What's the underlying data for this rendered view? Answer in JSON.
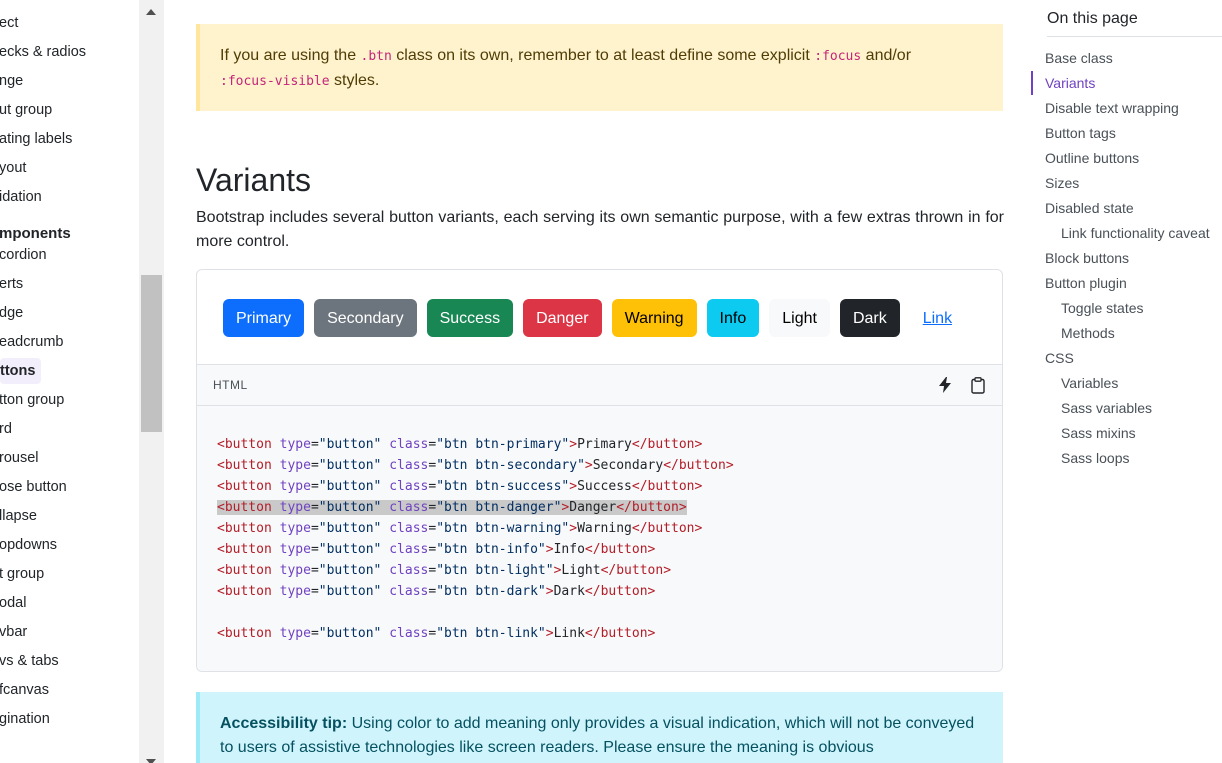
{
  "sidebar": {
    "items": [
      {
        "label": "ect",
        "kind": "item"
      },
      {
        "label": "ecks & radios",
        "kind": "item"
      },
      {
        "label": "nge",
        "kind": "item"
      },
      {
        "label": "ut group",
        "kind": "item"
      },
      {
        "label": "ating labels",
        "kind": "item"
      },
      {
        "label": "yout",
        "kind": "item"
      },
      {
        "label": "idation",
        "kind": "item"
      },
      {
        "label": "mponents",
        "kind": "heading"
      },
      {
        "label": "cordion",
        "kind": "item"
      },
      {
        "label": "erts",
        "kind": "item"
      },
      {
        "label": "dge",
        "kind": "item"
      },
      {
        "label": "eadcrumb",
        "kind": "item"
      },
      {
        "label": "ttons",
        "kind": "active"
      },
      {
        "label": "tton group",
        "kind": "item"
      },
      {
        "label": "rd",
        "kind": "item"
      },
      {
        "label": "rousel",
        "kind": "item"
      },
      {
        "label": "ose button",
        "kind": "item"
      },
      {
        "label": "llapse",
        "kind": "item"
      },
      {
        "label": "opdowns",
        "kind": "item"
      },
      {
        "label": "t group",
        "kind": "item"
      },
      {
        "label": "odal",
        "kind": "item"
      },
      {
        "label": "vbar",
        "kind": "item"
      },
      {
        "label": "vs & tabs",
        "kind": "item"
      },
      {
        "label": "fcanvas",
        "kind": "item"
      },
      {
        "label": "gination",
        "kind": "item"
      }
    ]
  },
  "callout_warning": {
    "before": "If you are using the ",
    "code1": ".btn",
    "middle": " class on its own, remember to at least define some explicit ",
    "code2": ":focus",
    "and": " and/or ",
    "code3": ":focus-visible",
    "after": " styles."
  },
  "section": {
    "title": "Variants",
    "lead": "Bootstrap includes several button variants, each serving its own semantic purpose, with a few extras thrown in for more control."
  },
  "buttons": [
    {
      "label": "Primary",
      "variant": "primary"
    },
    {
      "label": "Secondary",
      "variant": "secondary"
    },
    {
      "label": "Success",
      "variant": "success"
    },
    {
      "label": "Danger",
      "variant": "danger"
    },
    {
      "label": "Warning",
      "variant": "warning"
    },
    {
      "label": "Info",
      "variant": "info"
    },
    {
      "label": "Light",
      "variant": "light"
    },
    {
      "label": "Dark",
      "variant": "dark"
    },
    {
      "label": "Link",
      "variant": "link"
    }
  ],
  "code": {
    "language": "HTML",
    "lines": [
      {
        "cls": "btn btn-primary",
        "text": "Primary"
      },
      {
        "cls": "btn btn-secondary",
        "text": "Secondary"
      },
      {
        "cls": "btn btn-success",
        "text": "Success"
      },
      {
        "cls": "btn btn-danger",
        "text": "Danger",
        "highlighted": true
      },
      {
        "cls": "btn btn-warning",
        "text": "Warning"
      },
      {
        "cls": "btn btn-info",
        "text": "Info"
      },
      {
        "cls": "btn btn-light",
        "text": "Light"
      },
      {
        "cls": "btn btn-dark",
        "text": "Dark"
      },
      {
        "blank": true
      },
      {
        "cls": "btn btn-link",
        "text": "Link"
      }
    ]
  },
  "callout_info": {
    "strong": "Accessibility tip:",
    "text": " Using color to add meaning only provides a visual indication, which will not be conveyed to users of assistive technologies like screen readers. Please ensure the meaning is obvious"
  },
  "toc": {
    "title": "On this page",
    "links": [
      {
        "label": "Base class",
        "level": 1
      },
      {
        "label": "Variants",
        "level": 1,
        "active": true
      },
      {
        "label": "Disable text wrapping",
        "level": 1
      },
      {
        "label": "Button tags",
        "level": 1
      },
      {
        "label": "Outline buttons",
        "level": 1
      },
      {
        "label": "Sizes",
        "level": 1
      },
      {
        "label": "Disabled state",
        "level": 1
      },
      {
        "label": "Link functionality caveat",
        "level": 2
      },
      {
        "label": "Block buttons",
        "level": 1
      },
      {
        "label": "Button plugin",
        "level": 1
      },
      {
        "label": "Toggle states",
        "level": 2
      },
      {
        "label": "Methods",
        "level": 2
      },
      {
        "label": "CSS",
        "level": 1
      },
      {
        "label": "Variables",
        "level": 2
      },
      {
        "label": "Sass variables",
        "level": 2
      },
      {
        "label": "Sass mixins",
        "level": 2
      },
      {
        "label": "Sass loops",
        "level": 2
      }
    ]
  },
  "colors": {
    "accent": "#6f42c1",
    "primary": "#0d6efd",
    "warning_bg": "#fff3cd",
    "info_bg": "#cff4fc"
  }
}
